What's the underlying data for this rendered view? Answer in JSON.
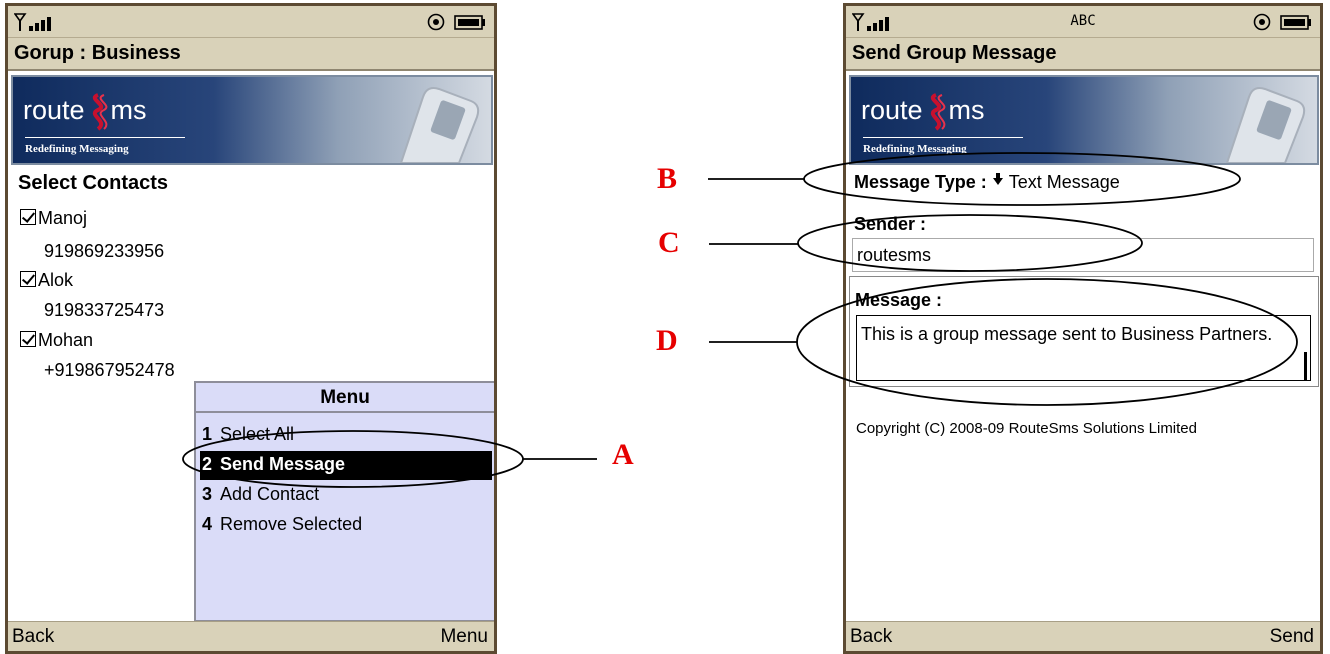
{
  "left_screen": {
    "title": "Gorup : Business",
    "banner": {
      "brand_left": "route",
      "brand_right": "ms",
      "tagline": "Redefining Messaging"
    },
    "section_title": "Select Contacts",
    "contacts": [
      {
        "name": "Manoj",
        "number": "919869233956",
        "checked": true
      },
      {
        "name": "Alok",
        "number": "919833725473",
        "checked": true
      },
      {
        "name": "Mohan",
        "number": "+919867952478",
        "checked": true
      }
    ],
    "menu": {
      "title": "Menu",
      "items": [
        {
          "number": "1",
          "label": "Select All"
        },
        {
          "number": "2",
          "label": "Send Message",
          "selected": true
        },
        {
          "number": "3",
          "label": "Add Contact"
        },
        {
          "number": "4",
          "label": "Remove Selected"
        }
      ]
    },
    "softkeys": {
      "left": "Back",
      "right": "Menu"
    }
  },
  "right_screen": {
    "status_text": "ABC",
    "title": "Send Group Message",
    "banner": {
      "brand_left": "route",
      "brand_right": "ms",
      "tagline": "Redefining Messaging"
    },
    "message_type": {
      "label": "Message Type :",
      "value": "Text Message"
    },
    "sender": {
      "label": "Sender :",
      "value": "routesms"
    },
    "message": {
      "label": "Message :",
      "value": "This is a group message sent to Business Partners."
    },
    "copyright": "Copyright (C) 2008-09 RouteSms Solutions Limited",
    "softkeys": {
      "left": "Back",
      "right": "Send"
    }
  },
  "annotations": {
    "a": "A",
    "b": "B",
    "c": "C",
    "d": "D"
  },
  "colors": {
    "bar_background": "#d9d2b9",
    "menu_background": "#dadcf8",
    "annotation_red": "#e60000",
    "phone_frame": "#5c4a32",
    "banner_navy": "#0f2b5d"
  }
}
